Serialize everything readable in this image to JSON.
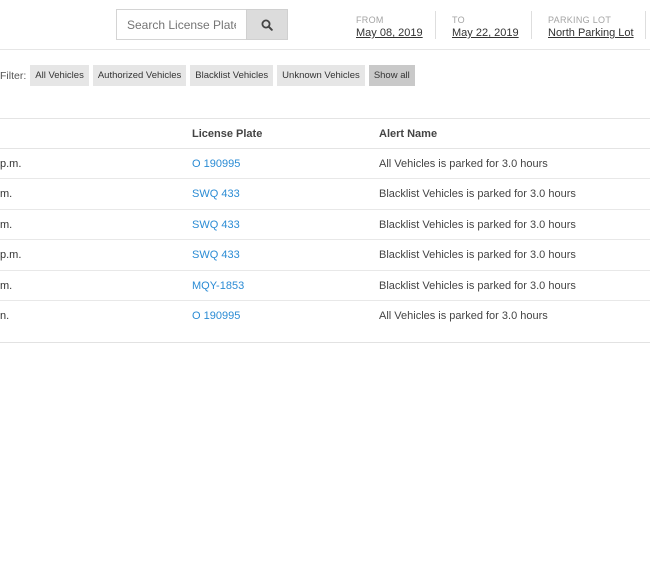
{
  "search": {
    "placeholder": "Search License Plate"
  },
  "date_range": {
    "from_label": "FROM",
    "from_value": "May 08, 2019",
    "to_label": "TO",
    "to_value": "May 22, 2019",
    "lot_label": "PARKING LOT",
    "lot_value": "North Parking Lot"
  },
  "filter": {
    "label": "Filter:",
    "chips": [
      "All Vehicles",
      "Authorized Vehicles",
      "Blacklist Vehicles",
      "Unknown Vehicles",
      "Show all"
    ],
    "active": "Show all"
  },
  "table": {
    "headers": {
      "plate": "License Plate",
      "alert": "Alert Name"
    },
    "rows": [
      {
        "time": "p.m.",
        "plate": "O 190995",
        "alert": "All Vehicles is parked for 3.0 hours"
      },
      {
        "time": "m.",
        "plate": "SWQ 433",
        "alert": "Blacklist Vehicles is parked for 3.0 hours"
      },
      {
        "time": "m.",
        "plate": "SWQ 433",
        "alert": "Blacklist Vehicles is parked for 3.0 hours"
      },
      {
        "time": "p.m.",
        "plate": "SWQ 433",
        "alert": "Blacklist Vehicles is parked for 3.0 hours"
      },
      {
        "time": "m.",
        "plate": "MQY-1853",
        "alert": "Blacklist Vehicles is parked for 3.0 hours"
      },
      {
        "time": "n.",
        "plate": "O 190995",
        "alert": "All Vehicles is parked for 3.0 hours"
      }
    ]
  },
  "icons": {
    "search_button": "search-icon"
  }
}
